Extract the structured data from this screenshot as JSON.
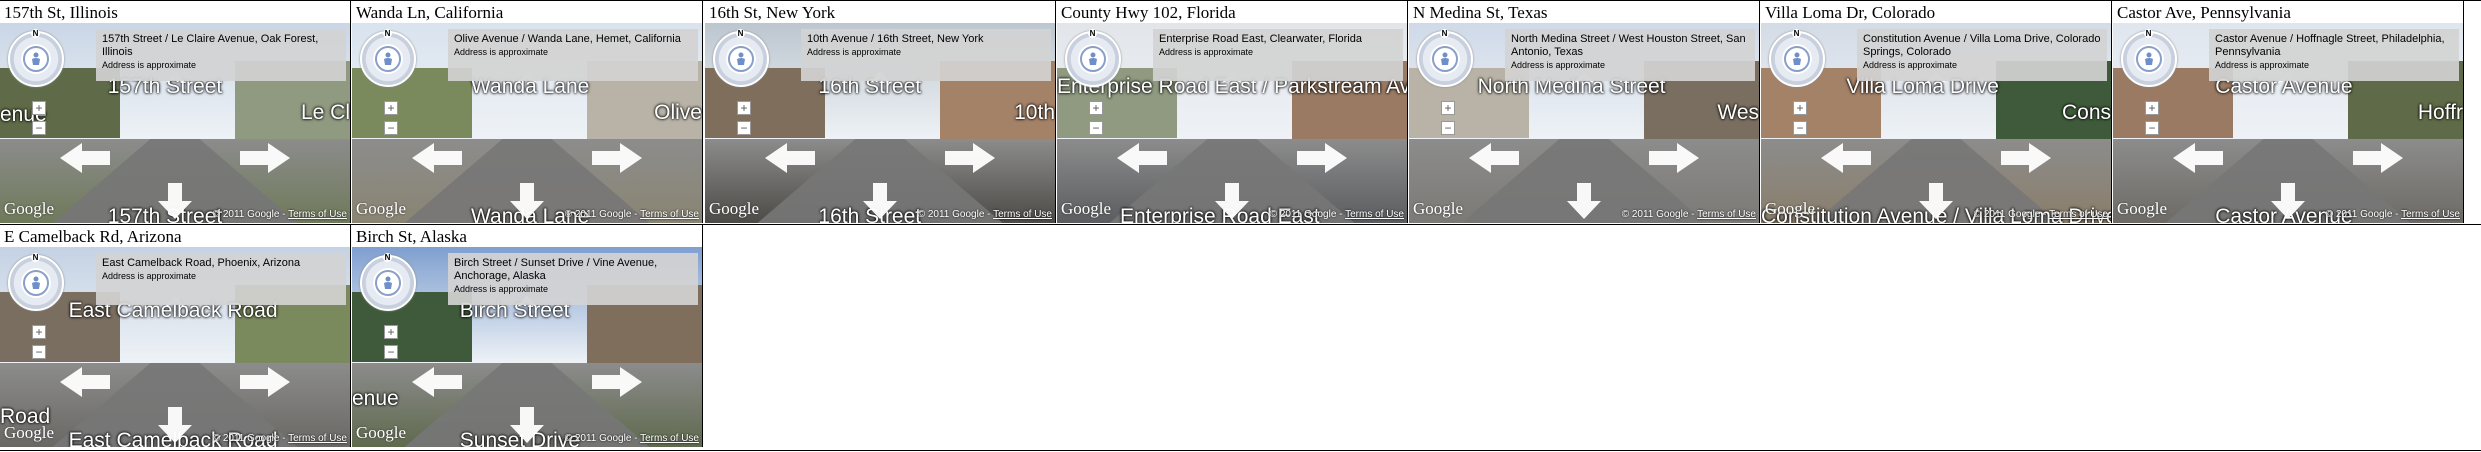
{
  "captions": [
    "157th St, Illinois",
    "Wanda Ln, California",
    "16th St, New York",
    "County Hwy 102, Florida",
    "N Medina St, Texas",
    "Villa Loma Dr, Colorado",
    "Castor Ave, Pennsylvania",
    "E Camelback Rd, Arizona",
    "Birch St, Alaska"
  ],
  "panels": [
    {
      "address": "157th Street / Le Claire Avenue, Oak Forest, Illinois",
      "street_top": "157th Street",
      "street_bottom": "157th Street",
      "street_left": "enue",
      "street_right": "Le Cl"
    },
    {
      "address": "Olive Avenue / Wanda Lane, Hemet, California",
      "street_top": "Wanda Lane",
      "street_bottom": "Wanda Lane",
      "street_left": "",
      "street_right": "Olive"
    },
    {
      "address": "10th Avenue / 16th Street, New York",
      "street_top": "16th Street",
      "street_bottom": "16th Street",
      "street_left": "",
      "street_right": "10th"
    },
    {
      "address": "Enterprise Road East, Clearwater, Florida",
      "street_top": "Enterprise Road East / Parkstream Avenue",
      "street_bottom": "Enterprise Road East",
      "street_left": "",
      "street_right": ""
    },
    {
      "address": "North Medina Street / West Houston Street, San Antonio, Texas",
      "street_top": "North Medina Street",
      "street_bottom": "",
      "street_left": "",
      "street_right": "Wes"
    },
    {
      "address": "Constitution Avenue / Villa Loma Drive, Colorado Springs, Colorado",
      "street_top": "Villa Loma Drive",
      "street_bottom": "Constitution Avenue / Villa Loma Drive",
      "street_left": "",
      "street_right": "Cons"
    },
    {
      "address": "Castor Avenue / Hoffnagle Street, Philadelphia, Pennsylvania",
      "street_top": "Castor Avenue",
      "street_bottom": "Castor Avenue",
      "street_left": "",
      "street_right": "Hoffr"
    },
    {
      "address": "East Camelback Road, Phoenix, Arizona",
      "street_top": "East Camelback Road",
      "street_bottom": "East Camelback Road",
      "street_left": "Road",
      "street_right": ""
    },
    {
      "address": "Birch Street / Sunset Drive / Vine Avenue, Anchorage, Alaska",
      "street_top": "Birch Street",
      "street_bottom": "Sunset Drive",
      "street_left": "enue",
      "street_right": ""
    }
  ],
  "common": {
    "approx": "Address is approximate",
    "google": "Google",
    "copyright": "© 2011 Google - ",
    "terms": "Terms of Use",
    "zoom_in": "+",
    "zoom_out": "−",
    "compass_n": "N"
  },
  "colors": {
    "sky": [
      "#c9d6e6",
      "#d9e3ee",
      "#bcc6cf",
      "#e2e6ea",
      "#cfd9e8",
      "#d3dbe6",
      "#dfe6ee",
      "#c4d2e4",
      "#7f9fd0"
    ],
    "ground": [
      "#6f7a5a",
      "#8a8573",
      "#4d4b47",
      "#5b5d60",
      "#7c7a76",
      "#8a7e6a",
      "#6e6b66",
      "#6a6864",
      "#5f6a4e"
    ],
    "building": [
      "#5f6b48",
      "#7b8a5c",
      "#7f6e5c",
      "#8f9a80",
      "#b8b3a6",
      "#a48268",
      "#9a7a62",
      "#7a6e60",
      "#3f5a3a"
    ]
  }
}
